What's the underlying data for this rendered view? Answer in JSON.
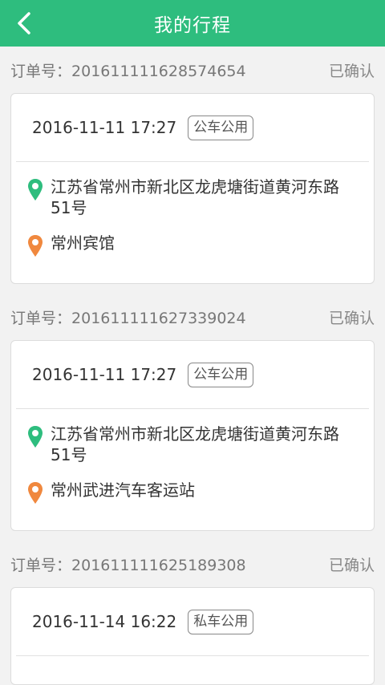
{
  "header": {
    "title": "我的行程"
  },
  "colors": {
    "brand": "#2ebd7e",
    "start_pin": "#2ebd7e",
    "end_pin": "#f0883e"
  },
  "icons": {
    "back": "chevron-left-icon",
    "start": "location-pin-icon",
    "end": "location-pin-icon"
  },
  "order_label": "订单号：",
  "orders": [
    {
      "order_no": "201611111628574654",
      "status": "已确认",
      "time": "2016-11-11 17:27",
      "tag": "公车公用",
      "start": "江苏省常州市新北区龙虎塘街道黄河东路51号",
      "end": "常州宾馆"
    },
    {
      "order_no": "201611111627339024",
      "status": "已确认",
      "time": "2016-11-11 17:27",
      "tag": "公车公用",
      "start": "江苏省常州市新北区龙虎塘街道黄河东路51号",
      "end": "常州武进汽车客运站"
    },
    {
      "order_no": "201611111625189308",
      "status": "已确认",
      "time": "2016-11-14 16:22",
      "tag": "私车公用",
      "start": "",
      "end": ""
    }
  ]
}
